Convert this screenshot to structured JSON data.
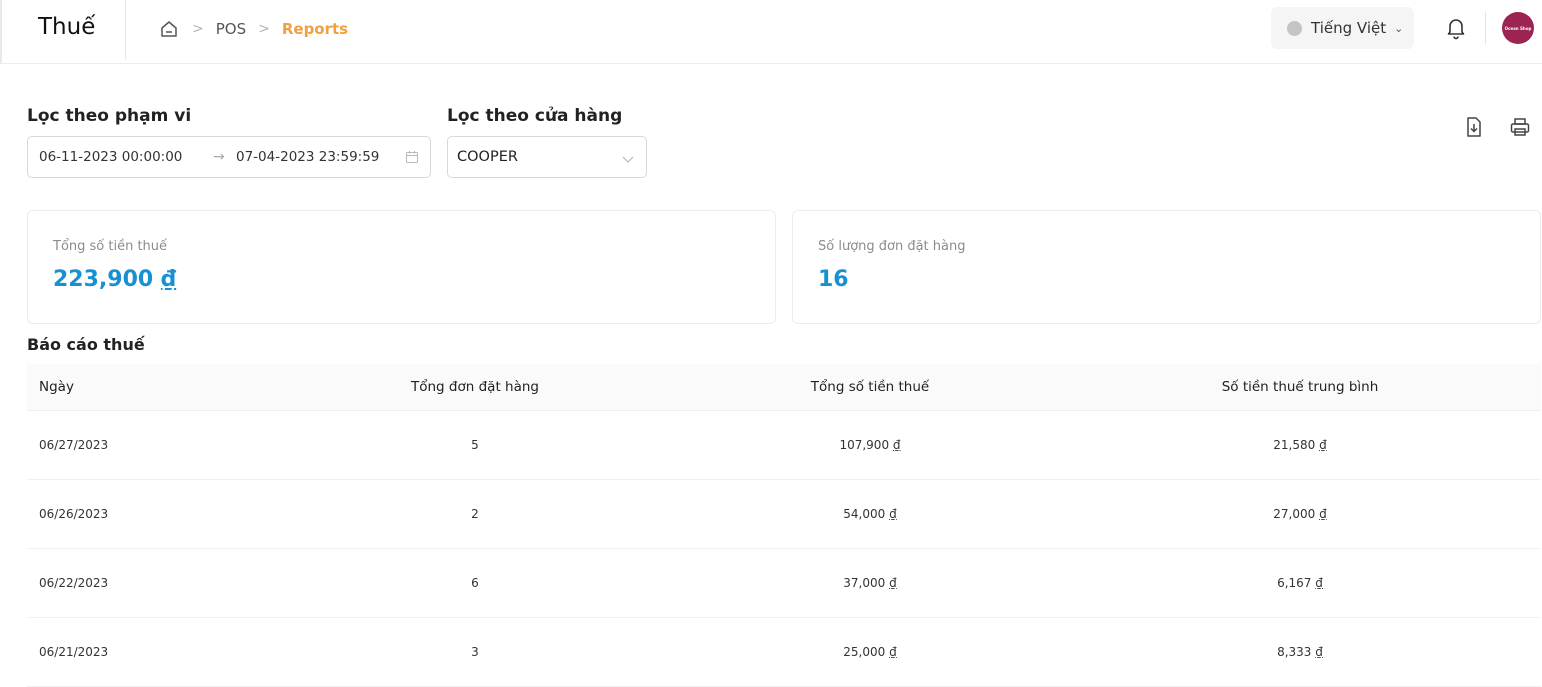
{
  "header": {
    "title": "Thuế",
    "breadcrumb": {
      "pos": "POS",
      "reports": "Reports"
    },
    "language": "Tiếng Việt",
    "avatar_text": "Ocean Shop"
  },
  "filters": {
    "range_label": "Lọc theo phạm vi",
    "range_start": "06-11-2023 00:00:00",
    "range_arrow": "→",
    "range_end": "07-04-2023 23:59:59",
    "store_label": "Lọc theo cửa hàng",
    "store_value": "COOPER"
  },
  "cards": {
    "total_tax_label": "Tổng số tiền thuế",
    "total_tax_amount": "223,900",
    "total_tax_currency": "₫",
    "order_count_label": "Số lượng đơn đặt hàng",
    "order_count_value": "16"
  },
  "table": {
    "title": "Báo cáo thuế",
    "columns": [
      "Ngày",
      "Tổng đơn đặt hàng",
      "Tổng số tiền thuế",
      "Số tiền thuế trung bình"
    ],
    "currency": "₫",
    "rows": [
      {
        "date": "06/27/2023",
        "orders": "5",
        "total_tax": "107,900",
        "avg_tax": "21,580"
      },
      {
        "date": "06/26/2023",
        "orders": "2",
        "total_tax": "54,000",
        "avg_tax": "27,000"
      },
      {
        "date": "06/22/2023",
        "orders": "6",
        "total_tax": "37,000",
        "avg_tax": "6,167"
      },
      {
        "date": "06/21/2023",
        "orders": "3",
        "total_tax": "25,000",
        "avg_tax": "8,333"
      }
    ]
  },
  "colors": {
    "accent": "#1890d4",
    "breadcrumb_active": "#f0a040",
    "avatar_bg": "#9b2452"
  },
  "icons": [
    "home-icon",
    "chevron-down-icon",
    "bell-icon",
    "calendar-icon",
    "download-icon",
    "print-icon"
  ]
}
